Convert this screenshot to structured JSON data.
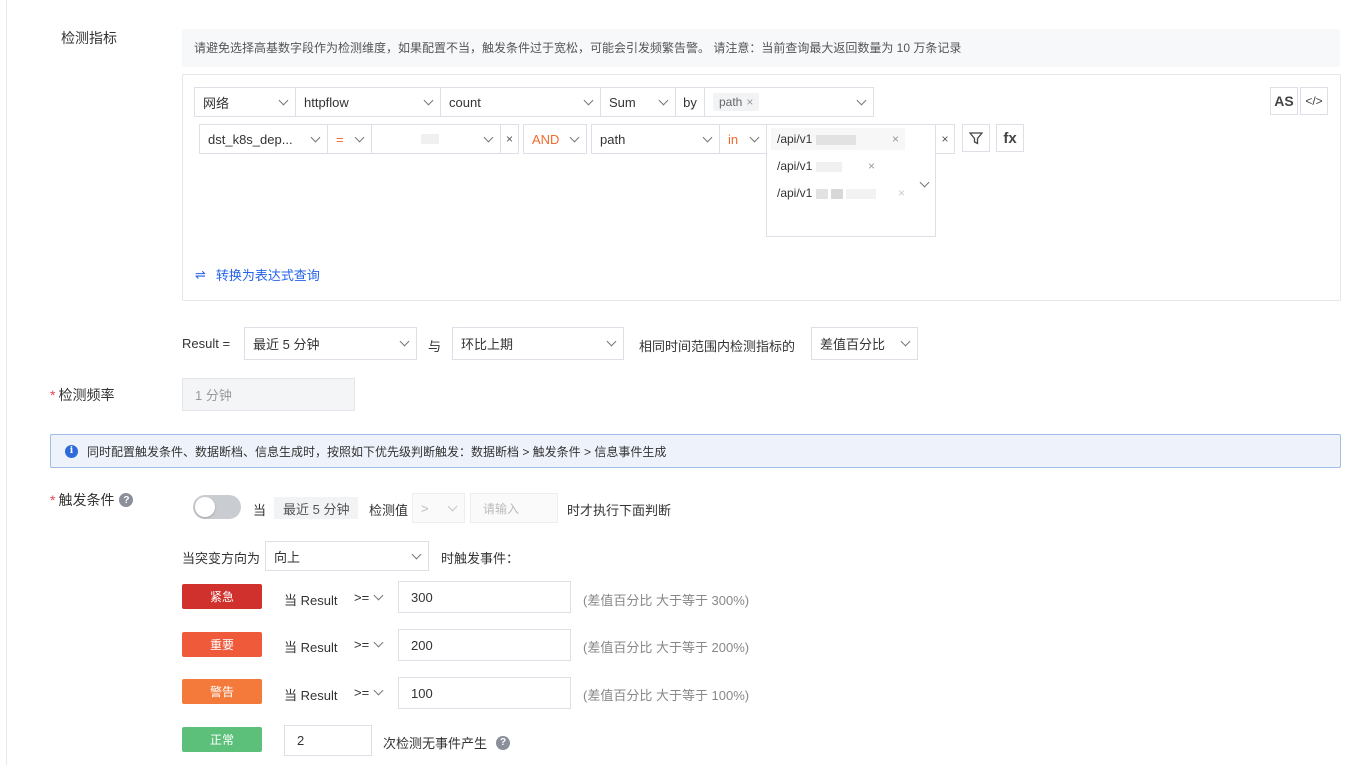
{
  "section_metric": {
    "label": "检测指标",
    "notice": "请避免选择高基数字段作为检测维度，如果配置不当，触发条件过于宽松，可能会引发频繁告警。 请注意：当前查询最大返回数量为 10 万条记录"
  },
  "query": {
    "source": "网络",
    "measurement": "httpflow",
    "field": "count",
    "aggregation": "Sum",
    "by_label": "by",
    "by_tag": "path",
    "as_button": "AS",
    "code_icon": "</>",
    "filter1": {
      "key": "dst_k8s_dep...",
      "op": "=",
      "value": ""
    },
    "logic": "AND",
    "filter2": {
      "key": "path",
      "op": "in",
      "values": [
        "/api/v1",
        "/api/v1",
        "/api/v1"
      ]
    },
    "fx_button": "fx",
    "convert_link": "转换为表达式查询"
  },
  "result_row": {
    "prefix": "Result =",
    "period": "最近 5 分钟",
    "with": "与",
    "compare": "环比上期",
    "middle": "相同时间范围内检测指标的",
    "metric": "差值百分比"
  },
  "frequency": {
    "label": "检测频率",
    "value": "1 分钟"
  },
  "info_banner": "同时配置触发条件、数据断档、信息生成时，按照如下优先级判断触发：数据断档 > 触发条件 > 信息事件生成",
  "trigger": {
    "label": "触发条件",
    "when": "当",
    "period_tag": "最近 5 分钟",
    "detect_value": "检测值",
    "op": ">",
    "placeholder": "请输入",
    "then": "时才执行下面判断",
    "direction_label": "当突变方向为",
    "direction": "向上",
    "direction_suffix": "时触发事件：",
    "levels": [
      {
        "name": "紧急",
        "cond": "当 Result",
        "op": ">=",
        "value": "300",
        "hint": "(差值百分比 大于等于 300%)",
        "color": "#d0312d"
      },
      {
        "name": "重要",
        "cond": "当 Result",
        "op": ">=",
        "value": "200",
        "hint": "(差值百分比 大于等于 200%)",
        "color": "#ef5a3a"
      },
      {
        "name": "警告",
        "cond": "当 Result",
        "op": ">=",
        "value": "100",
        "hint": "(差值百分比 大于等于 100%)",
        "color": "#f47a3c"
      }
    ],
    "normal": {
      "name": "正常",
      "value": "2",
      "suffix": "次检测无事件产生",
      "color": "#5cc07a"
    }
  }
}
